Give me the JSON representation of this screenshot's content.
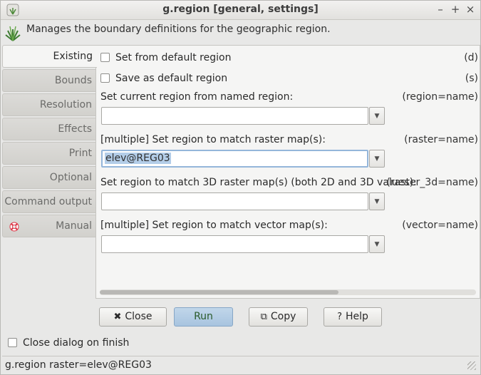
{
  "window": {
    "title": "g.region [general, settings]",
    "minimize": "–",
    "maximize": "+",
    "close": "×"
  },
  "description": "Manages the boundary definitions for the geographic region.",
  "tabs": [
    {
      "label": "Existing",
      "active": true
    },
    {
      "label": "Bounds"
    },
    {
      "label": "Resolution"
    },
    {
      "label": "Effects"
    },
    {
      "label": "Print"
    },
    {
      "label": "Optional"
    },
    {
      "label": "Command output"
    },
    {
      "label": "Manual",
      "icon": "lifebuoy-icon"
    }
  ],
  "panel": {
    "default_region": {
      "label": "Set from default region",
      "flag": "(d)",
      "checked": false
    },
    "save_default": {
      "label": "Save as default region",
      "flag": "(s)",
      "checked": false
    },
    "region_name": {
      "label": "Set current region from named region:",
      "param": "(region=name)",
      "value": ""
    },
    "raster": {
      "label": "[multiple] Set region to match raster map(s):",
      "param": "(raster=name)",
      "value": "elev@REG03"
    },
    "raster_3d": {
      "label": "Set region to match 3D raster map(s) (both 2D and 3D values):",
      "param": "(raster_3d=name)",
      "value": ""
    },
    "vector": {
      "label": "[multiple] Set region to match vector map(s):",
      "param": "(vector=name)",
      "value": ""
    },
    "dropdown_glyph": "▼"
  },
  "buttons": {
    "close": {
      "label": "Close",
      "icon": "✖"
    },
    "run": {
      "label": "Run"
    },
    "copy": {
      "label": "Copy",
      "icon": "⧉"
    },
    "help": {
      "label": "Help",
      "icon": "?"
    }
  },
  "close_on_finish": {
    "label": "Close dialog on finish",
    "checked": false
  },
  "status": "g.region raster=elev@REG03"
}
